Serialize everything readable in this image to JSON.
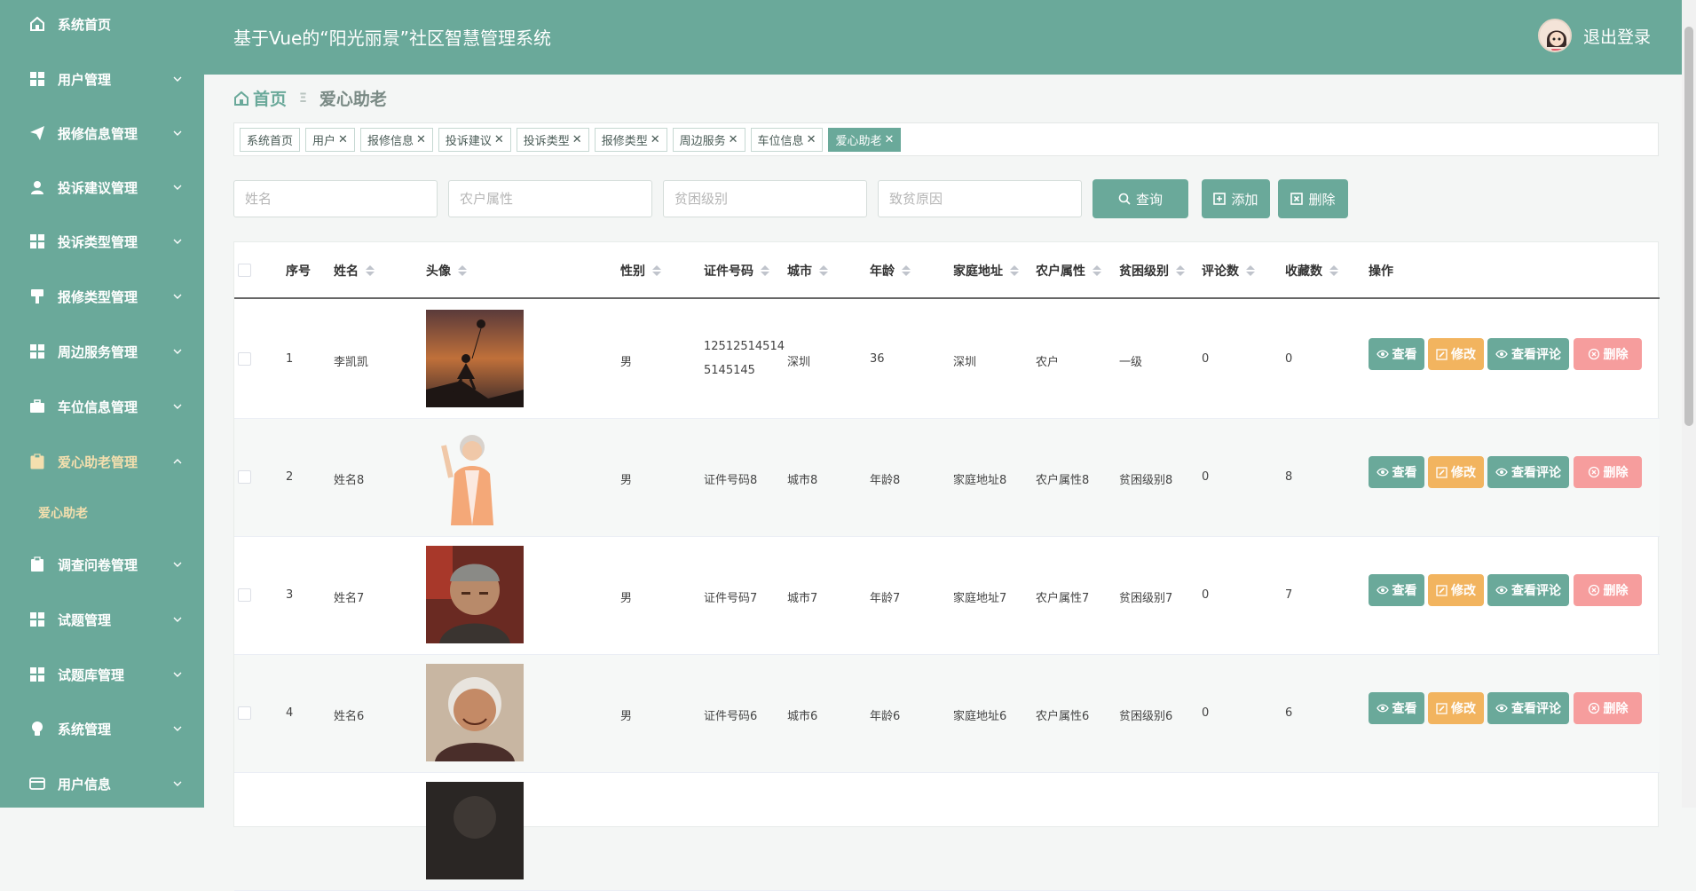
{
  "sidebar": {
    "items": [
      {
        "label": "系统首页",
        "icon": "home-icon",
        "chevron": false
      },
      {
        "label": "用户管理",
        "icon": "grid-icon",
        "chevron": "down"
      },
      {
        "label": "报修信息管理",
        "icon": "send-icon",
        "chevron": "down"
      },
      {
        "label": "投诉建议管理",
        "icon": "user-icon",
        "chevron": "down"
      },
      {
        "label": "投诉类型管理",
        "icon": "grid-icon",
        "chevron": "down"
      },
      {
        "label": "报修类型管理",
        "icon": "brush-icon",
        "chevron": "down"
      },
      {
        "label": "周边服务管理",
        "icon": "grid-icon",
        "chevron": "down"
      },
      {
        "label": "车位信息管理",
        "icon": "briefcase-icon",
        "chevron": "down"
      },
      {
        "label": "爱心助老管理",
        "icon": "clipboard-icon",
        "chevron": "up",
        "active": true
      },
      {
        "label": "调查问卷管理",
        "icon": "clipboard-icon",
        "chevron": "down"
      },
      {
        "label": "试题管理",
        "icon": "grid-icon",
        "chevron": "down"
      },
      {
        "label": "试题库管理",
        "icon": "grid-icon",
        "chevron": "down"
      },
      {
        "label": "系统管理",
        "icon": "bulb-icon",
        "chevron": "down"
      },
      {
        "label": "用户信息",
        "icon": "card-icon",
        "chevron": "down"
      }
    ],
    "submenu": "爱心助老"
  },
  "header": {
    "title": "基于Vue的“阳光丽景”社区智慧管理系统",
    "logout": "退出登录"
  },
  "breadcrumb": {
    "home": "首页",
    "separator": "Ξ",
    "current": "爱心助老"
  },
  "tags": [
    {
      "label": "系统首页",
      "closable": false
    },
    {
      "label": "用户",
      "closable": true
    },
    {
      "label": "报修信息",
      "closable": true
    },
    {
      "label": "投诉建议",
      "closable": true
    },
    {
      "label": "投诉类型",
      "closable": true
    },
    {
      "label": "报修类型",
      "closable": true
    },
    {
      "label": "周边服务",
      "closable": true
    },
    {
      "label": "车位信息",
      "closable": true
    },
    {
      "label": "爱心助老",
      "closable": true,
      "active": true
    }
  ],
  "search": {
    "name_placeholder": "姓名",
    "farmer_placeholder": "农户属性",
    "poverty_placeholder": "贫困级别",
    "cause_placeholder": "致贫原因",
    "query_label": "查询",
    "add_label": "添加",
    "delete_label": "删除"
  },
  "table": {
    "columns": [
      "序号",
      "姓名",
      "头像",
      "性别",
      "证件号码",
      "城市",
      "年龄",
      "家庭地址",
      "农户属性",
      "贫困级别",
      "评论数",
      "收藏数",
      "操作"
    ],
    "rows": [
      {
        "index": "1",
        "name": "李凯凯",
        "gender": "男",
        "id": "125125145145145145",
        "city": "深圳",
        "age": "36",
        "address": "深圳",
        "farmer": "农户",
        "level": "一级",
        "comments": "0",
        "favorites": "0",
        "photo": "balloon-girl-photo"
      },
      {
        "index": "2",
        "name": "姓名8",
        "gender": "男",
        "id": "证件号码8",
        "city": "城市8",
        "age": "年龄8",
        "address": "家庭地址8",
        "farmer": "农户属性8",
        "level": "贫困级别8",
        "comments": "0",
        "favorites": "8",
        "photo": "elderly-woman-photo"
      },
      {
        "index": "3",
        "name": "姓名7",
        "gender": "男",
        "id": "证件号码7",
        "city": "城市7",
        "age": "年龄7",
        "address": "家庭地址7",
        "farmer": "农户属性7",
        "level": "贫困级别7",
        "comments": "0",
        "favorites": "7",
        "photo": "elderly-man-photo"
      },
      {
        "index": "4",
        "name": "姓名6",
        "gender": "男",
        "id": "证件号码6",
        "city": "城市6",
        "age": "年龄6",
        "address": "家庭地址6",
        "farmer": "农户属性6",
        "level": "贫困级别6",
        "comments": "0",
        "favorites": "6",
        "photo": "elderly-woman-2-photo"
      }
    ],
    "actions": {
      "view": "查看",
      "edit": "修改",
      "comments": "查看评论",
      "delete": "删除"
    }
  },
  "colors": {
    "primary": "#6aa99a",
    "active_text": "#f4dfae",
    "edit": "#f2b45f",
    "delete": "#f69d9d"
  }
}
